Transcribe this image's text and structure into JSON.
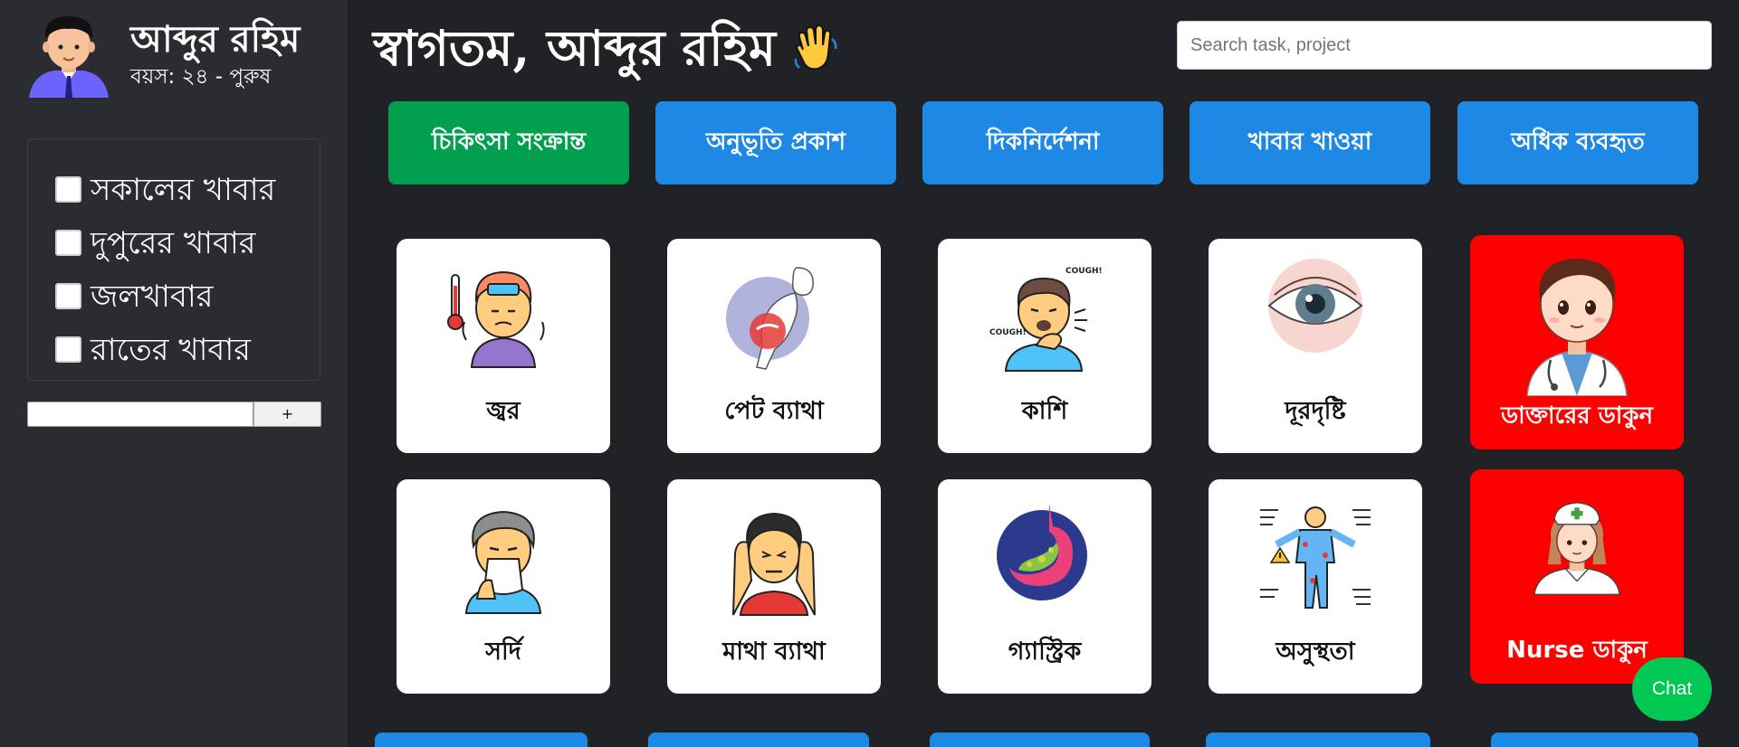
{
  "user": {
    "name": "আব্দুর রহিম",
    "meta": "বয়স: ২৪ - পুরুষ"
  },
  "meals": [
    {
      "label": "সকালের খাবার",
      "checked": false
    },
    {
      "label": "দুপুরের খাবার",
      "checked": false
    },
    {
      "label": "জলখাবার",
      "checked": false
    },
    {
      "label": "রাতের খাবার",
      "checked": false
    }
  ],
  "add_button_label": "+",
  "header": {
    "welcome": "স্বাগতম, আব্দুর রহিম",
    "wave_icon": "waving-hand-icon"
  },
  "search": {
    "placeholder": "Search task, project"
  },
  "tabs": [
    {
      "label": "চিকিৎসা সংক্রান্ত",
      "active": true
    },
    {
      "label": "অনুভূতি প্রকাশ",
      "active": false
    },
    {
      "label": "দিকনির্দেশনা",
      "active": false
    },
    {
      "label": "খাবার খাওয়া",
      "active": false
    },
    {
      "label": "অধিক ব্যবহৃত",
      "active": false
    }
  ],
  "cards": [
    {
      "label": "জ্বর",
      "icon": "fever-icon"
    },
    {
      "label": "পেট ব্যাথা",
      "icon": "stomach-pain-icon"
    },
    {
      "label": "কাশি",
      "icon": "cough-icon"
    },
    {
      "label": "দূরদৃষ্টি",
      "icon": "eye-icon"
    },
    {
      "label": "ডাক্তারের ডাকুন",
      "icon": "doctor-icon"
    },
    {
      "label": "সর্দি",
      "icon": "cold-icon"
    },
    {
      "label": "মাথা ব্যাথা",
      "icon": "headache-icon"
    },
    {
      "label": "গ্যাস্ট্রিক",
      "icon": "gastric-icon"
    },
    {
      "label": "অসুস্থতা",
      "icon": "illness-icon"
    },
    {
      "label": "Nurse ডাকুন",
      "icon": "nurse-icon"
    }
  ],
  "cough_text": "COUGH!",
  "chat_label": "Chat",
  "colors": {
    "active_tab": "#00a04f",
    "tab": "#1e88e5",
    "emergency": "#ff0000",
    "chat": "#00c853"
  }
}
